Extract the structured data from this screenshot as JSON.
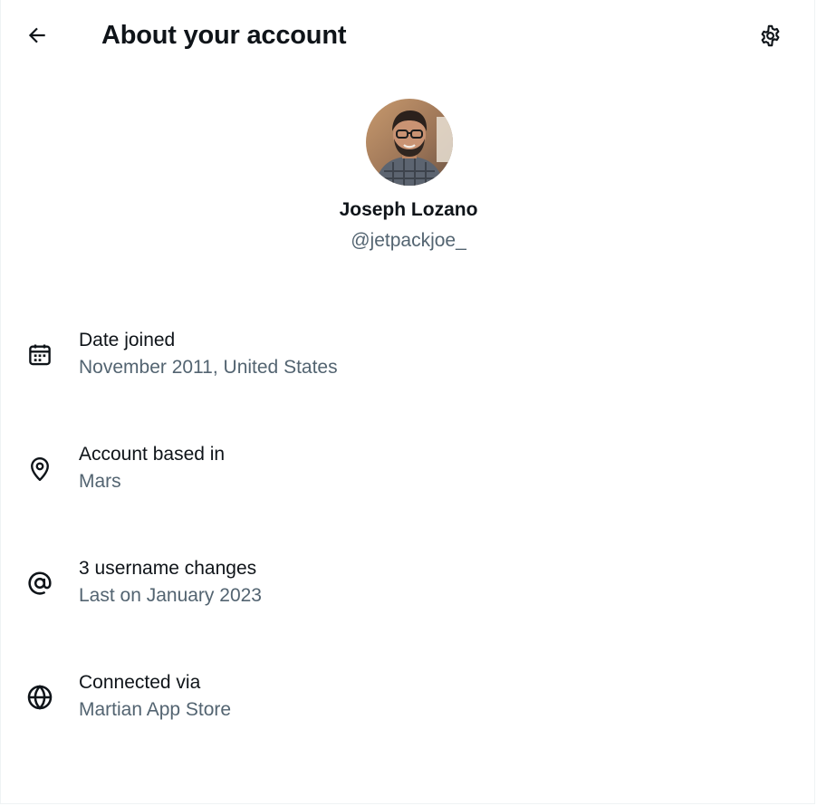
{
  "header": {
    "title": "About your account",
    "back_icon": "arrow-left-icon",
    "settings_icon": "gear-icon"
  },
  "profile": {
    "name": "Joseph Lozano",
    "handle": "@jetpackjoe_",
    "avatar": "avatar-photo"
  },
  "info": [
    {
      "icon": "calendar-icon",
      "label": "Date joined",
      "value": "November 2011, United States"
    },
    {
      "icon": "location-pin-icon",
      "label": "Account based in",
      "value": "Mars"
    },
    {
      "icon": "at-sign-icon",
      "label": "3 username changes",
      "value": "Last on January 2023"
    },
    {
      "icon": "globe-icon",
      "label": "Connected via",
      "value": "Martian App Store"
    }
  ],
  "colors": {
    "primary_text": "#0f1419",
    "secondary_text": "#536471",
    "background": "#ffffff",
    "border": "#eff3f4"
  }
}
